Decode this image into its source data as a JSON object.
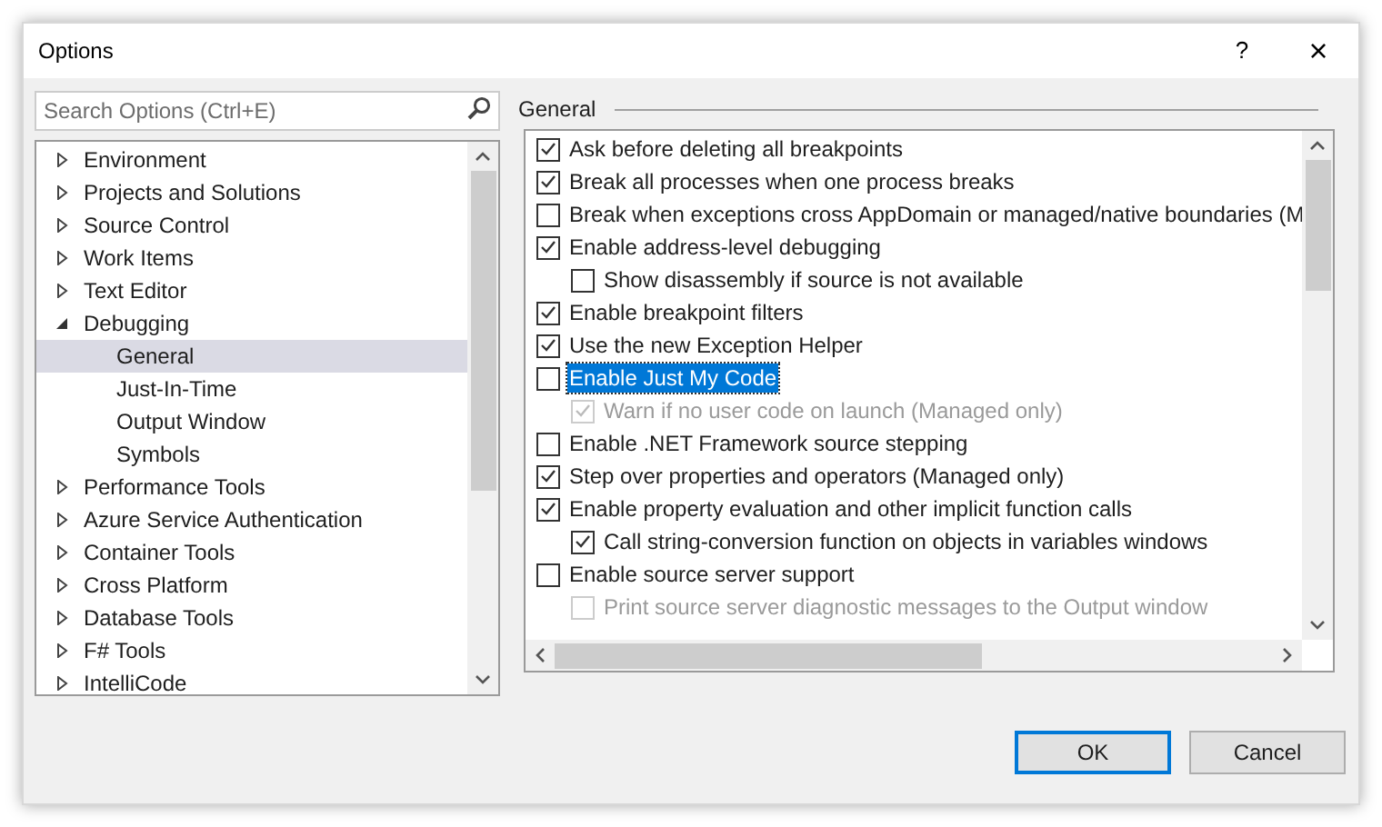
{
  "window": {
    "title": "Options",
    "help": "?",
    "close": "×"
  },
  "search": {
    "placeholder": "Search Options (Ctrl+E)"
  },
  "tree": [
    {
      "label": "Environment",
      "expanded": false,
      "selected": false
    },
    {
      "label": "Projects and Solutions",
      "expanded": false,
      "selected": false
    },
    {
      "label": "Source Control",
      "expanded": false,
      "selected": false
    },
    {
      "label": "Work Items",
      "expanded": false,
      "selected": false
    },
    {
      "label": "Text Editor",
      "expanded": false,
      "selected": false
    },
    {
      "label": "Debugging",
      "expanded": true,
      "selected": false,
      "children": [
        {
          "label": "General",
          "selected": true
        },
        {
          "label": "Just-In-Time",
          "selected": false
        },
        {
          "label": "Output Window",
          "selected": false
        },
        {
          "label": "Symbols",
          "selected": false
        }
      ]
    },
    {
      "label": "Performance Tools",
      "expanded": false,
      "selected": false
    },
    {
      "label": "Azure Service Authentication",
      "expanded": false,
      "selected": false
    },
    {
      "label": "Container Tools",
      "expanded": false,
      "selected": false
    },
    {
      "label": "Cross Platform",
      "expanded": false,
      "selected": false
    },
    {
      "label": "Database Tools",
      "expanded": false,
      "selected": false
    },
    {
      "label": "F# Tools",
      "expanded": false,
      "selected": false
    },
    {
      "label": "IntelliCode",
      "expanded": false,
      "selected": false
    }
  ],
  "section": {
    "title": "General"
  },
  "options": [
    {
      "label": "Ask before deleting all breakpoints",
      "checked": true,
      "disabled": false,
      "selected": false
    },
    {
      "label": "Break all processes when one process breaks",
      "checked": true,
      "disabled": false,
      "selected": false
    },
    {
      "label": "Break when exceptions cross AppDomain or managed/native boundaries (M",
      "checked": false,
      "disabled": false,
      "selected": false
    },
    {
      "label": "Enable address-level debugging",
      "checked": true,
      "disabled": false,
      "selected": false,
      "children": [
        {
          "label": "Show disassembly if source is not available",
          "checked": false,
          "disabled": false,
          "selected": false
        }
      ]
    },
    {
      "label": "Enable breakpoint filters",
      "checked": true,
      "disabled": false,
      "selected": false
    },
    {
      "label": "Use the new Exception Helper",
      "checked": true,
      "disabled": false,
      "selected": false
    },
    {
      "label": "Enable Just My Code",
      "checked": false,
      "disabled": false,
      "selected": true,
      "children": [
        {
          "label": "Warn if no user code on launch (Managed only)",
          "checked": true,
          "disabled": true,
          "selected": false
        }
      ]
    },
    {
      "label": "Enable .NET Framework source stepping",
      "checked": false,
      "disabled": false,
      "selected": false
    },
    {
      "label": "Step over properties and operators (Managed only)",
      "checked": true,
      "disabled": false,
      "selected": false
    },
    {
      "label": "Enable property evaluation and other implicit function calls",
      "checked": true,
      "disabled": false,
      "selected": false,
      "children": [
        {
          "label": "Call string-conversion function on objects in variables windows",
          "checked": true,
          "disabled": false,
          "selected": false
        }
      ]
    },
    {
      "label": "Enable source server support",
      "checked": false,
      "disabled": false,
      "selected": false,
      "children": [
        {
          "label": "Print source server diagnostic messages to the Output window",
          "checked": false,
          "disabled": true,
          "selected": false
        }
      ]
    }
  ],
  "buttons": [
    {
      "label": "OK",
      "kind": "default"
    },
    {
      "label": "Cancel",
      "kind": "normal"
    }
  ]
}
